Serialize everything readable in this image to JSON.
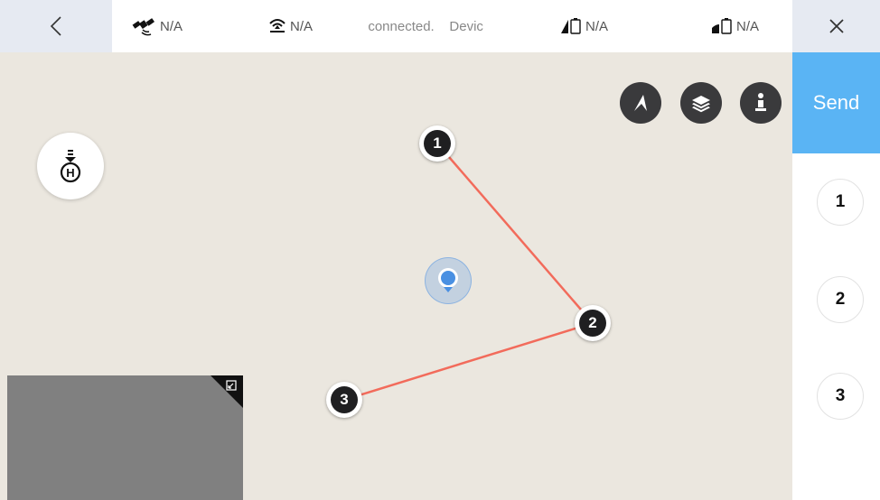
{
  "topbar": {
    "back_icon": "chevron-left-icon",
    "close_icon": "close-icon",
    "stats": [
      {
        "icon": "satellite-icon",
        "label": "N/A"
      },
      {
        "icon": "signal-icon",
        "label": "N/A"
      },
      {
        "icon": "remote-battery-icon",
        "label": "N/A"
      },
      {
        "icon": "aircraft-battery-icon",
        "label": "N/A"
      }
    ],
    "status_message": "t connected.    Devic"
  },
  "map": {
    "waypoints": [
      {
        "label": "1"
      },
      {
        "label": "2"
      },
      {
        "label": "3"
      }
    ],
    "route_color": "#f26b5b",
    "buttons": [
      {
        "icon": "compass-icon"
      },
      {
        "icon": "layers-icon"
      },
      {
        "icon": "info-icon"
      }
    ],
    "home_icon": "home-point-icon",
    "location_color": "#4a90e2"
  },
  "panel": {
    "send_label": "Send",
    "send_color": "#5ab4f4",
    "waypoint_list": [
      "1",
      "2",
      "3"
    ]
  }
}
